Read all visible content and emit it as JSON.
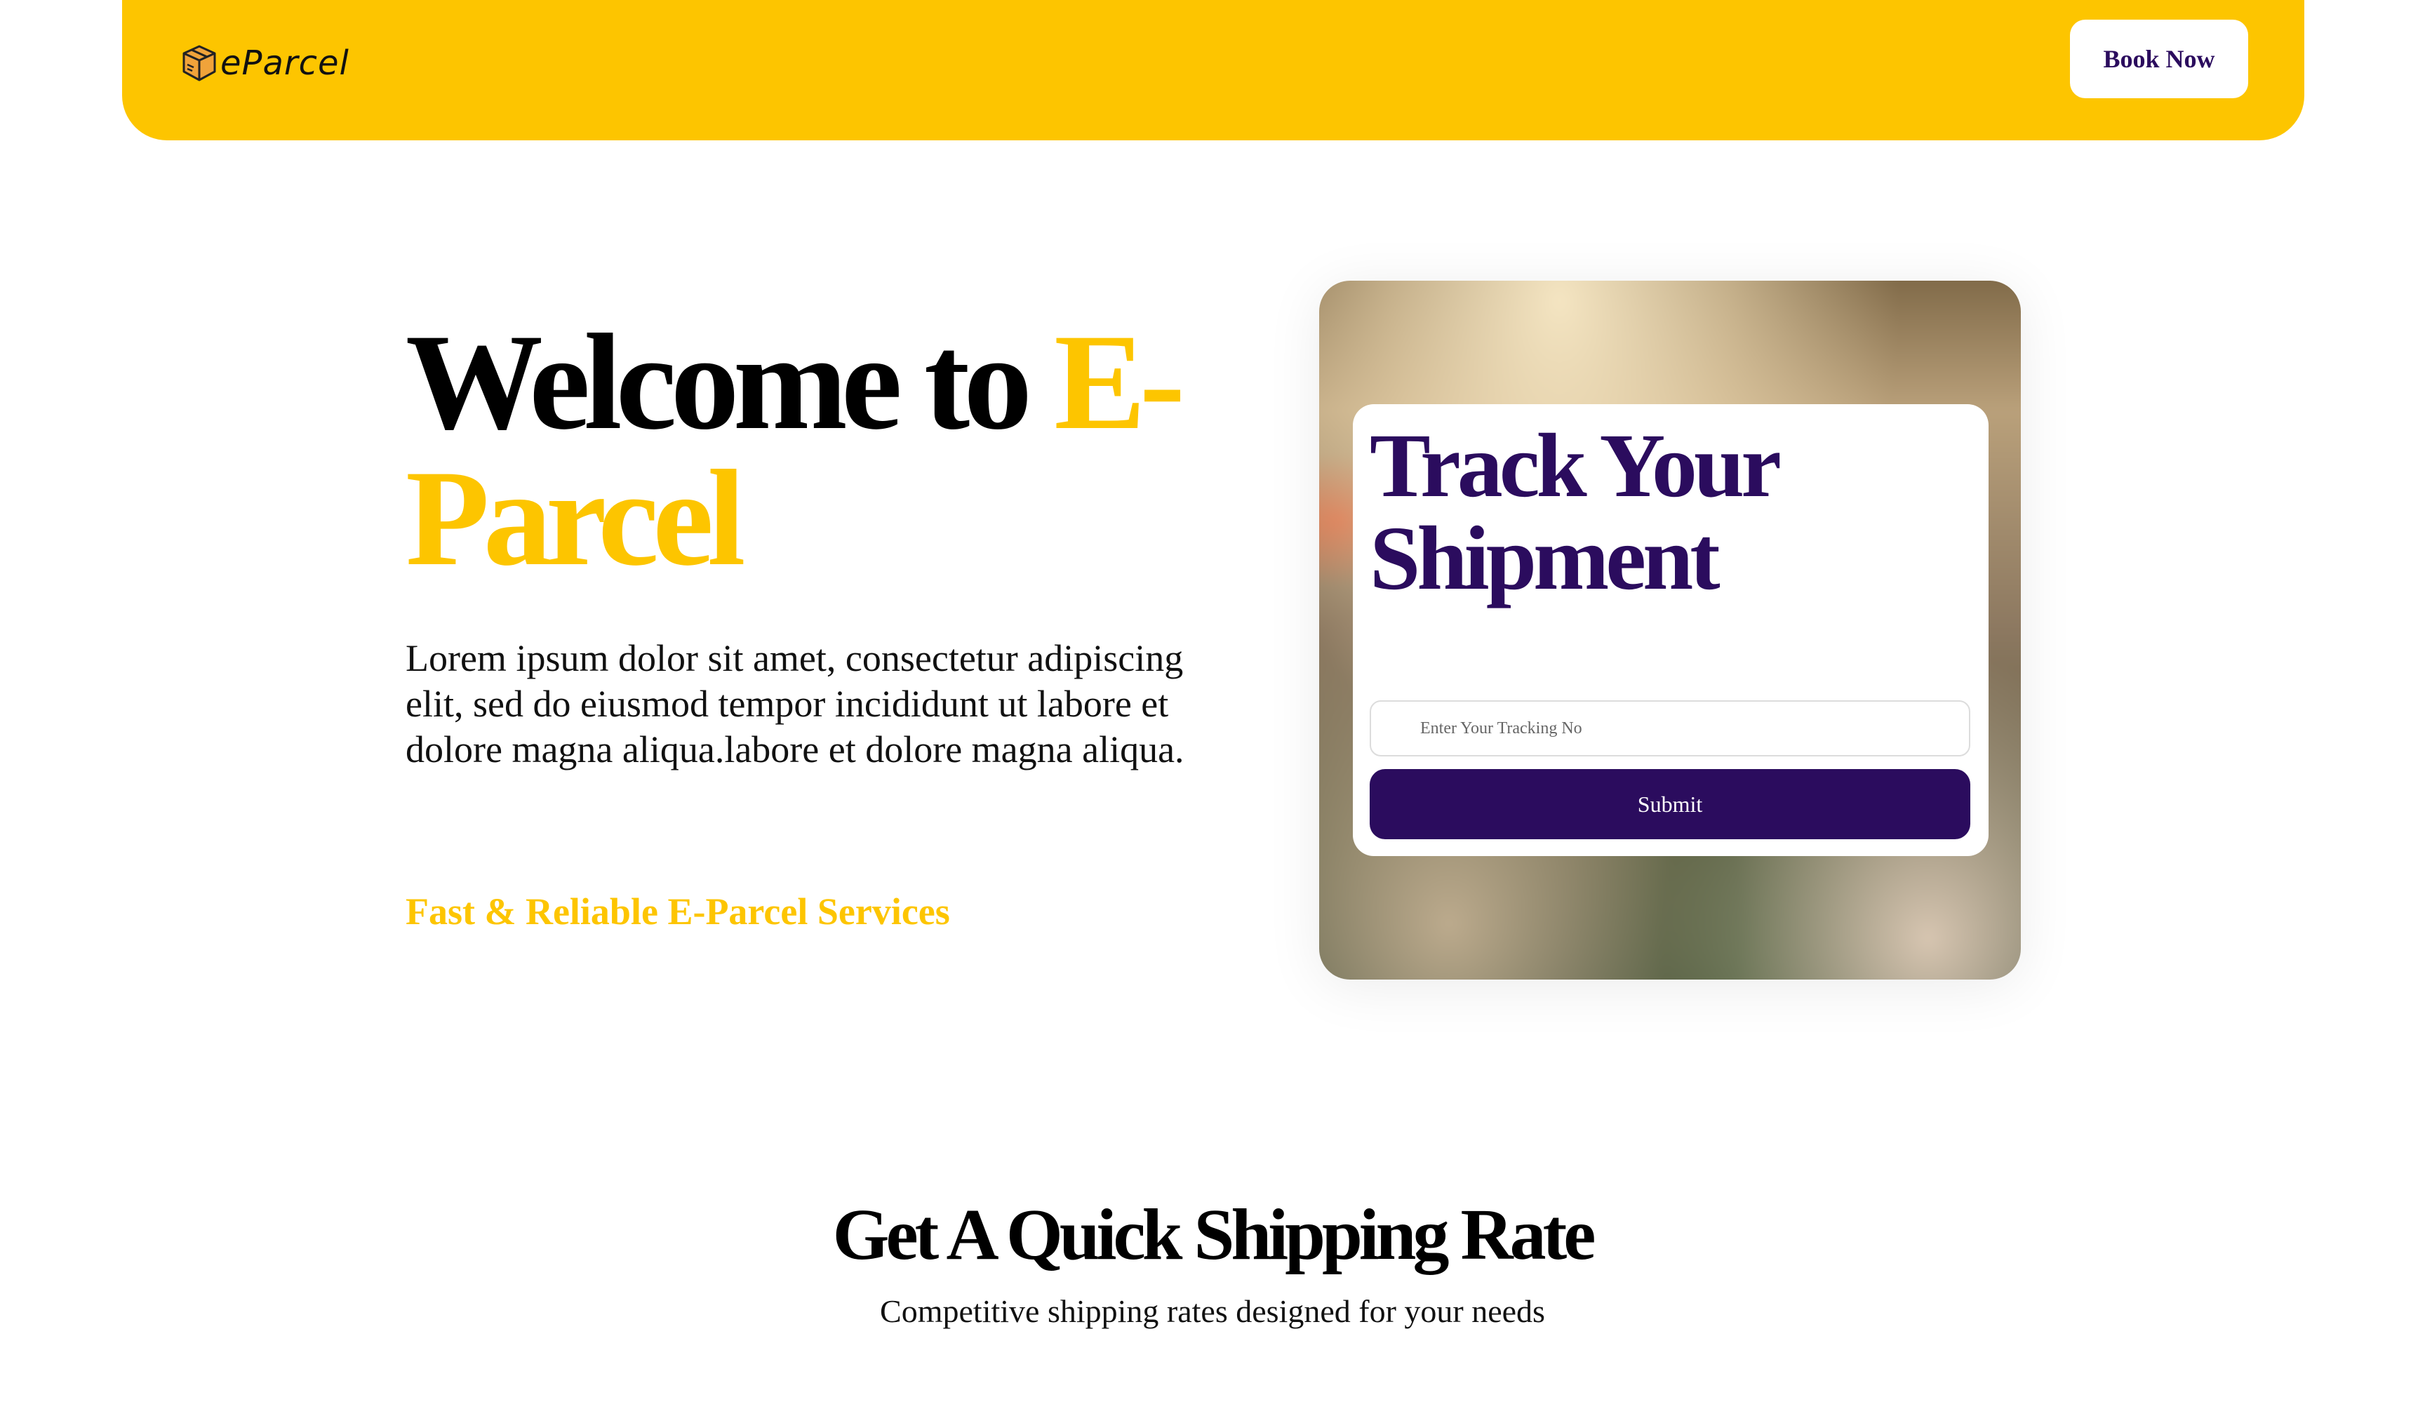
{
  "header": {
    "logo_text": "eParcel",
    "book_button_label": "Book Now"
  },
  "hero": {
    "title_prefix": "Welcome to ",
    "title_accent": "E-Parcel",
    "description": "Lorem ipsum dolor sit amet, consectetur adipiscing elit, sed do eiusmod tempor incididunt ut labore et dolore magna aliqua.labore et dolore magna aliqua.",
    "tagline": "Fast & Reliable E-Parcel Services"
  },
  "track": {
    "title": "Track Your Shipment",
    "input_placeholder": "Enter Your Tracking No",
    "submit_label": "Submit"
  },
  "rates": {
    "title": "Get A Quick Shipping Rate",
    "subtitle": "Competitive shipping rates designed for your needs"
  },
  "colors": {
    "brand_yellow": "#fdc500",
    "brand_purple": "#2b0c5e"
  }
}
